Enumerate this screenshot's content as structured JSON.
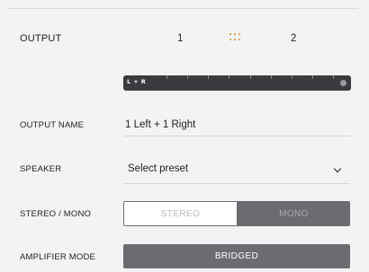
{
  "output": {
    "label": "OUTPUT",
    "channel_1": "1",
    "channel_2": "2",
    "linked": true
  },
  "meter": {
    "label": "L + R",
    "tick_count": 9,
    "led_status": "off"
  },
  "output_name": {
    "label": "OUTPUT NAME",
    "value": "1 Left + 1 Right"
  },
  "speaker": {
    "label": "SPEAKER",
    "selected": "Select preset"
  },
  "stereo_mono": {
    "label": "STEREO / MONO",
    "options": [
      "STEREO",
      "MONO"
    ],
    "selected": "MONO"
  },
  "amplifier_mode": {
    "label": "AMPLIFIER MODE",
    "value": "BRIDGED"
  },
  "colors": {
    "accent_link": "#e08a2e",
    "control_dark": "#6b6b72",
    "meter_bg": "#3b3b3f"
  }
}
